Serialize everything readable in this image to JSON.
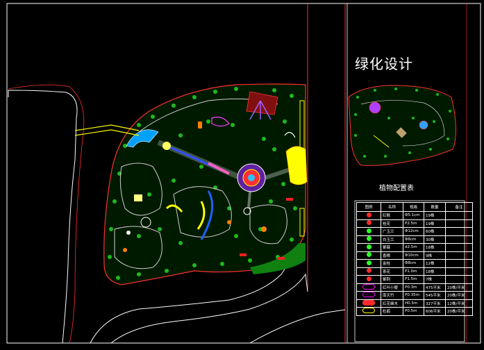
{
  "drawing": {
    "title": "绿化设计",
    "table_title": "植物配置表",
    "colors": {
      "background": "#000000",
      "frame": "#ffffff",
      "road_edge": "#ff2020",
      "green_dots": "#1fb81f",
      "accent_cyan": "#00e0ff",
      "accent_yellow": "#ffff00",
      "accent_magenta": "#ff00ff"
    }
  },
  "legend_table": {
    "headers": [
      "图例",
      "名称",
      "规格",
      "数量",
      "备注"
    ],
    "rows": [
      {
        "icon": "maple-tree-icon",
        "color": "#ff2a2a",
        "name": "红枫",
        "spec": "Φ5.1cm",
        "qty": "19株",
        "note": ""
      },
      {
        "icon": "osmanthus-icon",
        "color": "#ff2a2a",
        "name": "桂花",
        "spec": "P2.5m",
        "qty": "19株",
        "note": ""
      },
      {
        "icon": "magnolia-icon",
        "color": "#2aff2a",
        "name": "广玉兰",
        "spec": "Φ12cm",
        "qty": "60株",
        "note": ""
      },
      {
        "icon": "white-magnolia-icon",
        "color": "#2aff2a",
        "name": "白玉兰",
        "spec": "Φ8cm",
        "qty": "30株",
        "note": ""
      },
      {
        "icon": "ginkgo-icon",
        "color": "#2aff2a",
        "name": "紫薇",
        "spec": "d2.5m",
        "qty": "18株",
        "note": ""
      },
      {
        "icon": "camphor-tree-icon",
        "color": "#2aff2a",
        "name": "香樟",
        "spec": "Φ10cm",
        "qty": "9株",
        "note": ""
      },
      {
        "icon": "crabapple-icon",
        "color": "#2aff2a",
        "name": "金桂",
        "spec": "Φ8cm",
        "qty": "12株",
        "note": ""
      },
      {
        "icon": "tea-flower-icon",
        "color": "#ff2a2a",
        "name": "茶花",
        "spec": "P1.0m",
        "qty": "18株",
        "note": ""
      },
      {
        "icon": "rhododendron-icon",
        "color": "#ff2a2a",
        "name": "紫荆",
        "spec": "P1.5m",
        "qty": "7株",
        "note": ""
      },
      {
        "icon": "boxwood-hedge-icon",
        "color": "#ff00ff",
        "name": "红叶小檗",
        "spec": "P0.3m",
        "qty": "475平米",
        "note": "20株/平米"
      },
      {
        "icon": "bamboo-hedge-icon",
        "color": "#ff00ff",
        "name": "南天竹",
        "spec": "P0.35m",
        "qty": "545平米",
        "note": "20株/平米"
      },
      {
        "icon": "loropetalum-icon",
        "color": "#ff2a2a",
        "name": "红花继木",
        "spec": "H0.5m",
        "qty": "327平米",
        "note": "12株/平米"
      },
      {
        "icon": "azalea-icon",
        "color": "#ffff00",
        "name": "杜鹃",
        "spec": "P0.5m",
        "qty": "606平米",
        "note": "20株/平米"
      }
    ]
  }
}
